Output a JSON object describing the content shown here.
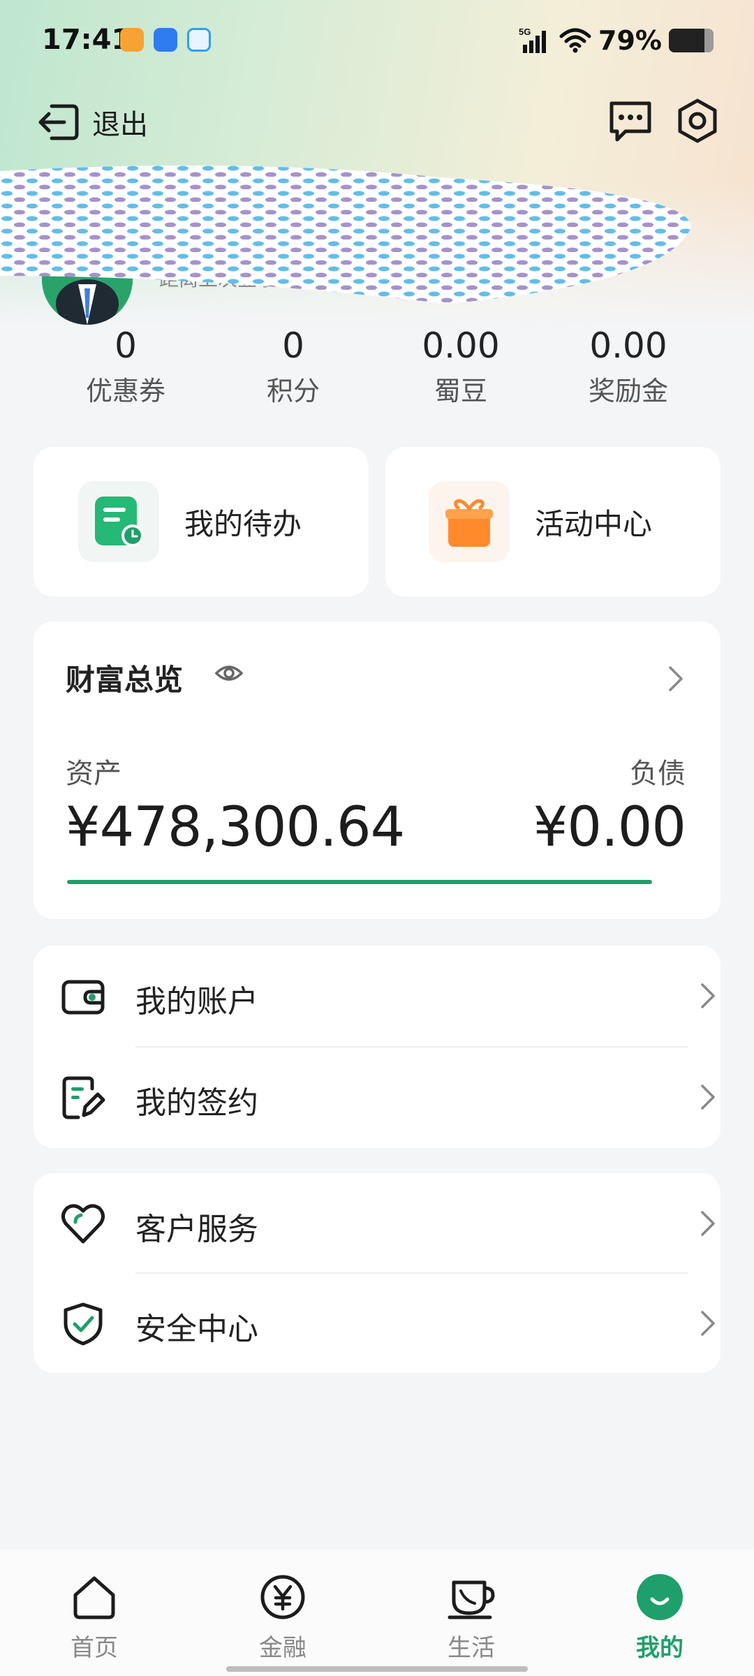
{
  "status_bar": {
    "time": "17:41",
    "network": "5G",
    "battery": "79%",
    "battery_level": 0.79
  },
  "header": {
    "logout_label": "退出"
  },
  "profile": {
    "subtitle": "距离上次登录"
  },
  "stats": [
    {
      "value": "0",
      "label": "优惠券"
    },
    {
      "value": "0",
      "label": "积分"
    },
    {
      "value": "0.00",
      "label": "蜀豆"
    },
    {
      "value": "0.00",
      "label": "奖励金"
    }
  ],
  "shortcuts": [
    {
      "label": "我的待办",
      "icon": "todo-icon"
    },
    {
      "label": "活动中心",
      "icon": "gift-icon"
    }
  ],
  "wealth": {
    "title": "财富总览",
    "asset_label": "资产",
    "asset_value": "¥478,300.64",
    "liability_label": "负债",
    "liability_value": "¥0.00",
    "asset_ratio": 1.0
  },
  "menu_group_1": [
    {
      "label": "我的账户",
      "icon": "wallet-icon"
    },
    {
      "label": "我的签约",
      "icon": "contract-icon"
    }
  ],
  "menu_group_2": [
    {
      "label": "客户服务",
      "icon": "heart-service-icon"
    },
    {
      "label": "安全中心",
      "icon": "shield-check-icon"
    }
  ],
  "bottom_nav": [
    {
      "label": "首页",
      "icon": "home-icon",
      "active": false
    },
    {
      "label": "金融",
      "icon": "yuan-icon",
      "active": false
    },
    {
      "label": "生活",
      "icon": "cup-icon",
      "active": false
    },
    {
      "label": "我的",
      "icon": "smile-icon",
      "active": true
    }
  ],
  "colors": {
    "accent": "#1f9f6b",
    "background": "#f4f5f7",
    "card": "#ffffff",
    "gift": "#ff8a2b"
  }
}
